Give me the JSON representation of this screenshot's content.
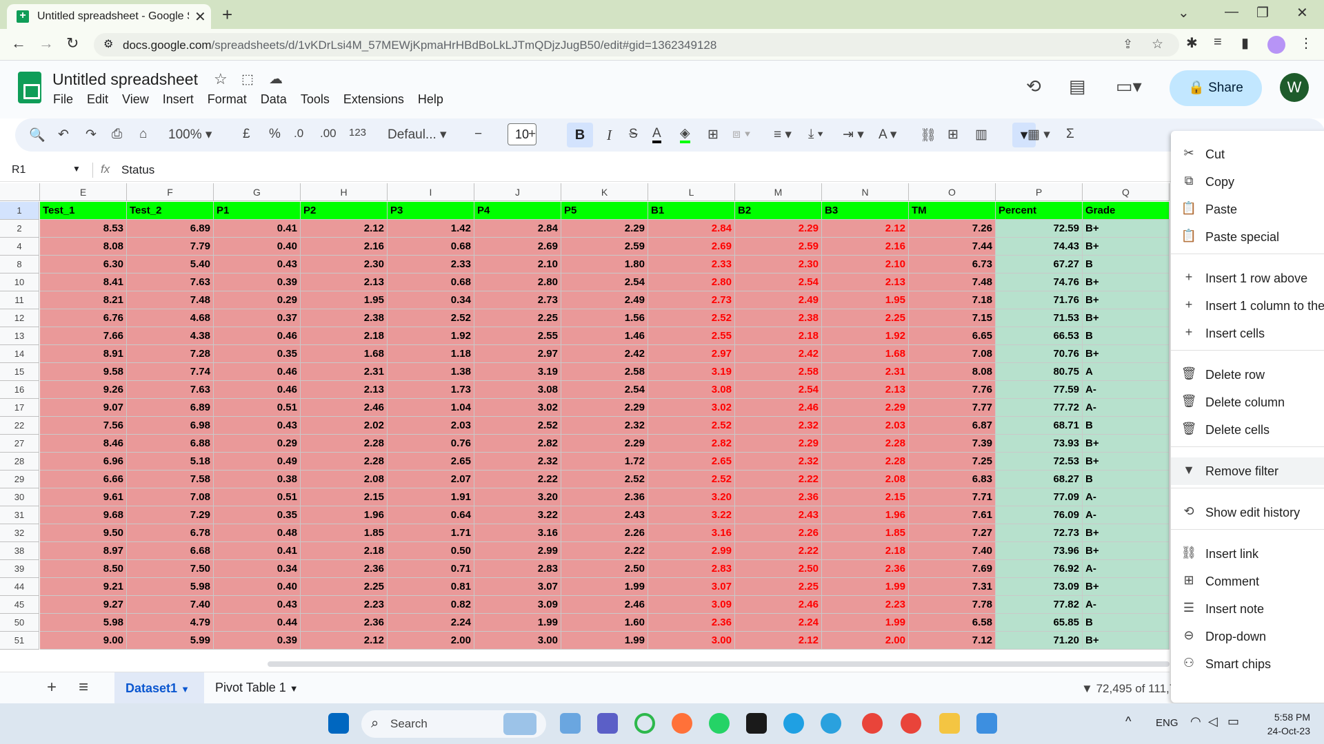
{
  "browser": {
    "tab_title": "Untitled spreadsheet - Google S",
    "url_host": "docs.google.com",
    "url_path": "/spreadsheets/d/1vKDrLsi4M_57MEWjKpmaHrHBdBoLkLJTmQDjzJugB50/edit#gid=1362349128"
  },
  "app": {
    "title": "Untitled spreadsheet",
    "menus": [
      "File",
      "Edit",
      "View",
      "Insert",
      "Format",
      "Data",
      "Tools",
      "Extensions",
      "Help"
    ],
    "share_label": "Share",
    "avatar_letter": "W"
  },
  "toolbar": {
    "zoom": "100%",
    "currency": "£",
    "percent": "%",
    "dec_less": ".0",
    "dec_more": ".00",
    "num_format": "123",
    "font": "Defaul...",
    "font_size": "10",
    "bold": "B",
    "italic": "I"
  },
  "formula": {
    "cell_ref": "R1",
    "fx": "fx",
    "value": "Status"
  },
  "grid": {
    "columns": [
      "E",
      "F",
      "G",
      "H",
      "I",
      "J",
      "K",
      "L",
      "M",
      "N",
      "O",
      "P",
      "Q"
    ],
    "headers": [
      "Test_1",
      "Test_2",
      "P1",
      "P2",
      "P3",
      "P4",
      "P5",
      "B1",
      "B2",
      "B3",
      "TM",
      "Percent",
      "Grade"
    ],
    "row_numbers": [
      "2",
      "4",
      "8",
      "10",
      "11",
      "12",
      "13",
      "14",
      "15",
      "16",
      "17",
      "22",
      "27",
      "28",
      "29",
      "30",
      "31",
      "32",
      "38",
      "39",
      "44",
      "45",
      "50",
      "51"
    ],
    "rows": [
      [
        "8.53",
        "6.89",
        "0.41",
        "2.12",
        "1.42",
        "2.84",
        "2.29",
        "2.84",
        "2.29",
        "2.12",
        "7.26",
        "72.59",
        "B+"
      ],
      [
        "8.08",
        "7.79",
        "0.40",
        "2.16",
        "0.68",
        "2.69",
        "2.59",
        "2.69",
        "2.59",
        "2.16",
        "7.44",
        "74.43",
        "B+"
      ],
      [
        "6.30",
        "5.40",
        "0.43",
        "2.30",
        "2.33",
        "2.10",
        "1.80",
        "2.33",
        "2.30",
        "2.10",
        "6.73",
        "67.27",
        "B"
      ],
      [
        "8.41",
        "7.63",
        "0.39",
        "2.13",
        "0.68",
        "2.80",
        "2.54",
        "2.80",
        "2.54",
        "2.13",
        "7.48",
        "74.76",
        "B+"
      ],
      [
        "8.21",
        "7.48",
        "0.29",
        "1.95",
        "0.34",
        "2.73",
        "2.49",
        "2.73",
        "2.49",
        "1.95",
        "7.18",
        "71.76",
        "B+"
      ],
      [
        "6.76",
        "4.68",
        "0.37",
        "2.38",
        "2.52",
        "2.25",
        "1.56",
        "2.52",
        "2.38",
        "2.25",
        "7.15",
        "71.53",
        "B+"
      ],
      [
        "7.66",
        "4.38",
        "0.46",
        "2.18",
        "1.92",
        "2.55",
        "1.46",
        "2.55",
        "2.18",
        "1.92",
        "6.65",
        "66.53",
        "B"
      ],
      [
        "8.91",
        "7.28",
        "0.35",
        "1.68",
        "1.18",
        "2.97",
        "2.42",
        "2.97",
        "2.42",
        "1.68",
        "7.08",
        "70.76",
        "B+"
      ],
      [
        "9.58",
        "7.74",
        "0.46",
        "2.31",
        "1.38",
        "3.19",
        "2.58",
        "3.19",
        "2.58",
        "2.31",
        "8.08",
        "80.75",
        "A"
      ],
      [
        "9.26",
        "7.63",
        "0.46",
        "2.13",
        "1.73",
        "3.08",
        "2.54",
        "3.08",
        "2.54",
        "2.13",
        "7.76",
        "77.59",
        "A-"
      ],
      [
        "9.07",
        "6.89",
        "0.51",
        "2.46",
        "1.04",
        "3.02",
        "2.29",
        "3.02",
        "2.46",
        "2.29",
        "7.77",
        "77.72",
        "A-"
      ],
      [
        "7.56",
        "6.98",
        "0.43",
        "2.02",
        "2.03",
        "2.52",
        "2.32",
        "2.52",
        "2.32",
        "2.03",
        "6.87",
        "68.71",
        "B"
      ],
      [
        "8.46",
        "6.88",
        "0.29",
        "2.28",
        "0.76",
        "2.82",
        "2.29",
        "2.82",
        "2.29",
        "2.28",
        "7.39",
        "73.93",
        "B+"
      ],
      [
        "6.96",
        "5.18",
        "0.49",
        "2.28",
        "2.65",
        "2.32",
        "1.72",
        "2.65",
        "2.32",
        "2.28",
        "7.25",
        "72.53",
        "B+"
      ],
      [
        "6.66",
        "7.58",
        "0.38",
        "2.08",
        "2.07",
        "2.22",
        "2.52",
        "2.52",
        "2.22",
        "2.08",
        "6.83",
        "68.27",
        "B"
      ],
      [
        "9.61",
        "7.08",
        "0.51",
        "2.15",
        "1.91",
        "3.20",
        "2.36",
        "3.20",
        "2.36",
        "2.15",
        "7.71",
        "77.09",
        "A-"
      ],
      [
        "9.68",
        "7.29",
        "0.35",
        "1.96",
        "0.64",
        "3.22",
        "2.43",
        "3.22",
        "2.43",
        "1.96",
        "7.61",
        "76.09",
        "A-"
      ],
      [
        "9.50",
        "6.78",
        "0.48",
        "1.85",
        "1.71",
        "3.16",
        "2.26",
        "3.16",
        "2.26",
        "1.85",
        "7.27",
        "72.73",
        "B+"
      ],
      [
        "8.97",
        "6.68",
        "0.41",
        "2.18",
        "0.50",
        "2.99",
        "2.22",
        "2.99",
        "2.22",
        "2.18",
        "7.40",
        "73.96",
        "B+"
      ],
      [
        "8.50",
        "7.50",
        "0.34",
        "2.36",
        "0.71",
        "2.83",
        "2.50",
        "2.83",
        "2.50",
        "2.36",
        "7.69",
        "76.92",
        "A-"
      ],
      [
        "9.21",
        "5.98",
        "0.40",
        "2.25",
        "0.81",
        "3.07",
        "1.99",
        "3.07",
        "2.25",
        "1.99",
        "7.31",
        "73.09",
        "B+"
      ],
      [
        "9.27",
        "7.40",
        "0.43",
        "2.23",
        "0.82",
        "3.09",
        "2.46",
        "3.09",
        "2.46",
        "2.23",
        "7.78",
        "77.82",
        "A-"
      ],
      [
        "5.98",
        "4.79",
        "0.44",
        "2.36",
        "2.24",
        "1.99",
        "1.60",
        "2.36",
        "2.24",
        "1.99",
        "6.58",
        "65.85",
        "B"
      ],
      [
        "9.00",
        "5.99",
        "0.39",
        "2.12",
        "2.00",
        "3.00",
        "1.99",
        "3.00",
        "2.12",
        "2.00",
        "7.12",
        "71.20",
        "B+"
      ]
    ]
  },
  "sheets": {
    "tabs": [
      "Dataset1",
      "Pivot Table 1"
    ],
    "filter_count": "72,495 of 111,7"
  },
  "context_menu": {
    "items": [
      {
        "label": "Cut",
        "icon": "scissors-icon",
        "glyph": "✂"
      },
      {
        "label": "Copy",
        "icon": "copy-icon",
        "glyph": "⧉"
      },
      {
        "label": "Paste",
        "icon": "paste-icon",
        "glyph": "📋"
      },
      {
        "label": "Paste special",
        "icon": "paste-special-icon",
        "glyph": "📋"
      },
      {
        "label": "Insert 1 row above",
        "icon": "plus-icon",
        "glyph": "+"
      },
      {
        "label": "Insert 1 column to the",
        "icon": "plus-icon",
        "glyph": "+"
      },
      {
        "label": "Insert cells",
        "icon": "plus-icon",
        "glyph": "+"
      },
      {
        "label": "Delete row",
        "icon": "trash-icon",
        "glyph": "🗑"
      },
      {
        "label": "Delete column",
        "icon": "trash-icon",
        "glyph": "🗑"
      },
      {
        "label": "Delete cells",
        "icon": "trash-icon",
        "glyph": "🗑"
      },
      {
        "label": "Remove filter",
        "icon": "filter-icon",
        "glyph": "▼"
      },
      {
        "label": "Show edit history",
        "icon": "history-icon",
        "glyph": "⟲"
      },
      {
        "label": "Insert link",
        "icon": "link-icon",
        "glyph": "⛓"
      },
      {
        "label": "Comment",
        "icon": "comment-icon",
        "glyph": "⊞"
      },
      {
        "label": "Insert note",
        "icon": "note-icon",
        "glyph": "☰"
      },
      {
        "label": "Drop-down",
        "icon": "dropdown-icon",
        "glyph": "⊖"
      },
      {
        "label": "Smart chips",
        "icon": "chips-icon",
        "glyph": "⚇"
      }
    ]
  },
  "taskbar": {
    "search_label": "Search",
    "lang": "ENG",
    "time": "5:58 PM",
    "date": "24-Oct-23"
  },
  "colors": {
    "header_green": "#00ff00",
    "row_red": "#ea9999",
    "percent_green": "#b7e1cd",
    "bold_red_text": "#ff0000"
  }
}
